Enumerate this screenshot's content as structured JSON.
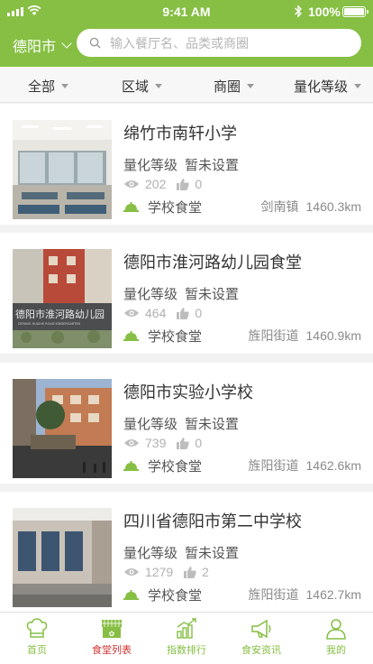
{
  "status_bar": {
    "time": "9:41 AM",
    "battery": "100%"
  },
  "header": {
    "city": "德阳市",
    "search_placeholder": "输入餐厅名、品类或商圈"
  },
  "filters": [
    {
      "label": "全部"
    },
    {
      "label": "区域"
    },
    {
      "label": "商圈"
    },
    {
      "label": "量化等级"
    }
  ],
  "restaurants": [
    {
      "name": "绵竹市南轩小学",
      "grade_label": "量化等级",
      "grade_value": "暂未设置",
      "views": "202",
      "likes": "0",
      "category": "学校食堂",
      "area": "剑南镇",
      "distance": "1460.3km"
    },
    {
      "name": "德阳市淮河路幼儿园食堂",
      "grade_label": "量化等级",
      "grade_value": "暂未设置",
      "views": "464",
      "likes": "0",
      "category": "学校食堂",
      "area": "旌阳街道",
      "distance": "1460.9km",
      "sign_text_cn": "德阳市淮河路幼儿园",
      "sign_text_en": "DEYANG HUAIHE ROAD KINDERGARTEN"
    },
    {
      "name": "德阳市实验小学校",
      "grade_label": "量化等级",
      "grade_value": "暂未设置",
      "views": "739",
      "likes": "0",
      "category": "学校食堂",
      "area": "旌阳街道",
      "distance": "1462.6km"
    },
    {
      "name": "四川省德阳市第二中学校",
      "grade_label": "量化等级",
      "grade_value": "暂未设置",
      "views": "1279",
      "likes": "2",
      "category": "学校食堂",
      "area": "旌阳街道",
      "distance": "1462.7km"
    }
  ],
  "tabbar": [
    {
      "label": "首页",
      "icon": "chef-hat-icon"
    },
    {
      "label": "食堂列表",
      "icon": "storefront-icon",
      "active": true
    },
    {
      "label": "指数排行",
      "icon": "bar-chart-icon"
    },
    {
      "label": "食安资讯",
      "icon": "megaphone-icon"
    },
    {
      "label": "我的",
      "icon": "person-icon"
    }
  ],
  "colors": {
    "brand_green": "#86bf43",
    "active_tab": "#d0302e",
    "text_primary": "#333333",
    "text_muted": "#b0b0b0"
  }
}
